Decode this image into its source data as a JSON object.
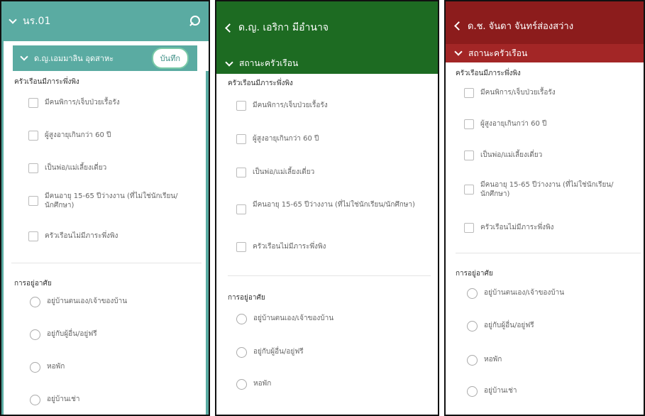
{
  "panel1": {
    "header_title": "นร.01",
    "person_name": "ด.ญ.เอมมาลิน อุดสาหะ",
    "save_label": "บันทึก",
    "dependents": {
      "title": "ครัวเรือนมีภาระพึ่งพิง",
      "options": [
        "มีคนพิการ/เจ็บป่วยเรื้อรัง",
        "ผู้สูงอายุเกินกว่า 60 ปี",
        "เป็นพ่อ/แม่เลี้ยงเดี่ยว",
        "มีคนอายุ 15-65 ปีว่างงาน (ที่ไม่ใช่นักเรียน/นักศึกษา)",
        "ครัวเรือนไม่มีภาระพึ่งพิง"
      ]
    },
    "housing": {
      "title": "การอยู่อาศัย",
      "options": [
        "อยู่บ้านตนเอง/เจ้าของบ้าน",
        "อยู่กับผู้อื่น/อยู่ฟรี",
        "หอพัก",
        "อยู่บ้านเช่า"
      ]
    }
  },
  "panel2": {
    "person_name": "ด.ญ. เอริกา มีอำนาจ",
    "section_label": "สถานะครัวเรือน",
    "dependents": {
      "title": "ครัวเรือนมีภาระพึ่งพิง",
      "options": [
        "มีคนพิการ/เจ็บป่วยเรื้อรัง",
        "ผู้สูงอายุเกินกว่า 60 ปี",
        "เป็นพ่อ/แม่เลี้ยงเดี่ยว",
        "มีคนอายุ 15-65 ปีว่างงาน (ที่ไม่ใช่นักเรียน/นักศึกษา)",
        "ครัวเรือนไม่มีภาระพึ่งพิง"
      ]
    },
    "housing": {
      "title": "การอยู่อาศัย",
      "options": [
        "อยู่บ้านตนเอง/เจ้าของบ้าน",
        "อยู่กับผู้อื่น/อยู่ฟรี",
        "หอพัก"
      ]
    }
  },
  "panel3": {
    "person_name": "ด.ช. จันดา จันทร์ส่องสว่าง",
    "section_label": "สถานะครัวเรือน",
    "dependents": {
      "title": "ครัวเรือนมีภาระพึ่งพิง",
      "options": [
        "มีคนพิการ/เจ็บป่วยเรื้อรัง",
        "ผู้สูงอายุเกินกว่า 60 ปี",
        "เป็นพ่อ/แม่เลี้ยงเดี่ยว",
        "มีคนอายุ 15-65 ปีว่างงาน (ที่ไม่ใช่นักเรียน/นักศึกษา)",
        "ครัวเรือนไม่มีภาระพึ่งพิง"
      ]
    },
    "housing": {
      "title": "การอยู่อาศัย",
      "options": [
        "อยู่บ้านตนเอง/เจ้าของบ้าน",
        "อยู่กับผู้อื่น/อยู่ฟรี",
        "หอพัก",
        "อยู่บ้านเช่า"
      ]
    }
  },
  "colors": {
    "teal": "#5aaba2",
    "green": "#1d6b22",
    "red": "#8c1c1c"
  },
  "icons": [
    "chevron-down-icon",
    "search-icon",
    "back-chevron-icon",
    "checkbox-icon",
    "radio-icon"
  ]
}
